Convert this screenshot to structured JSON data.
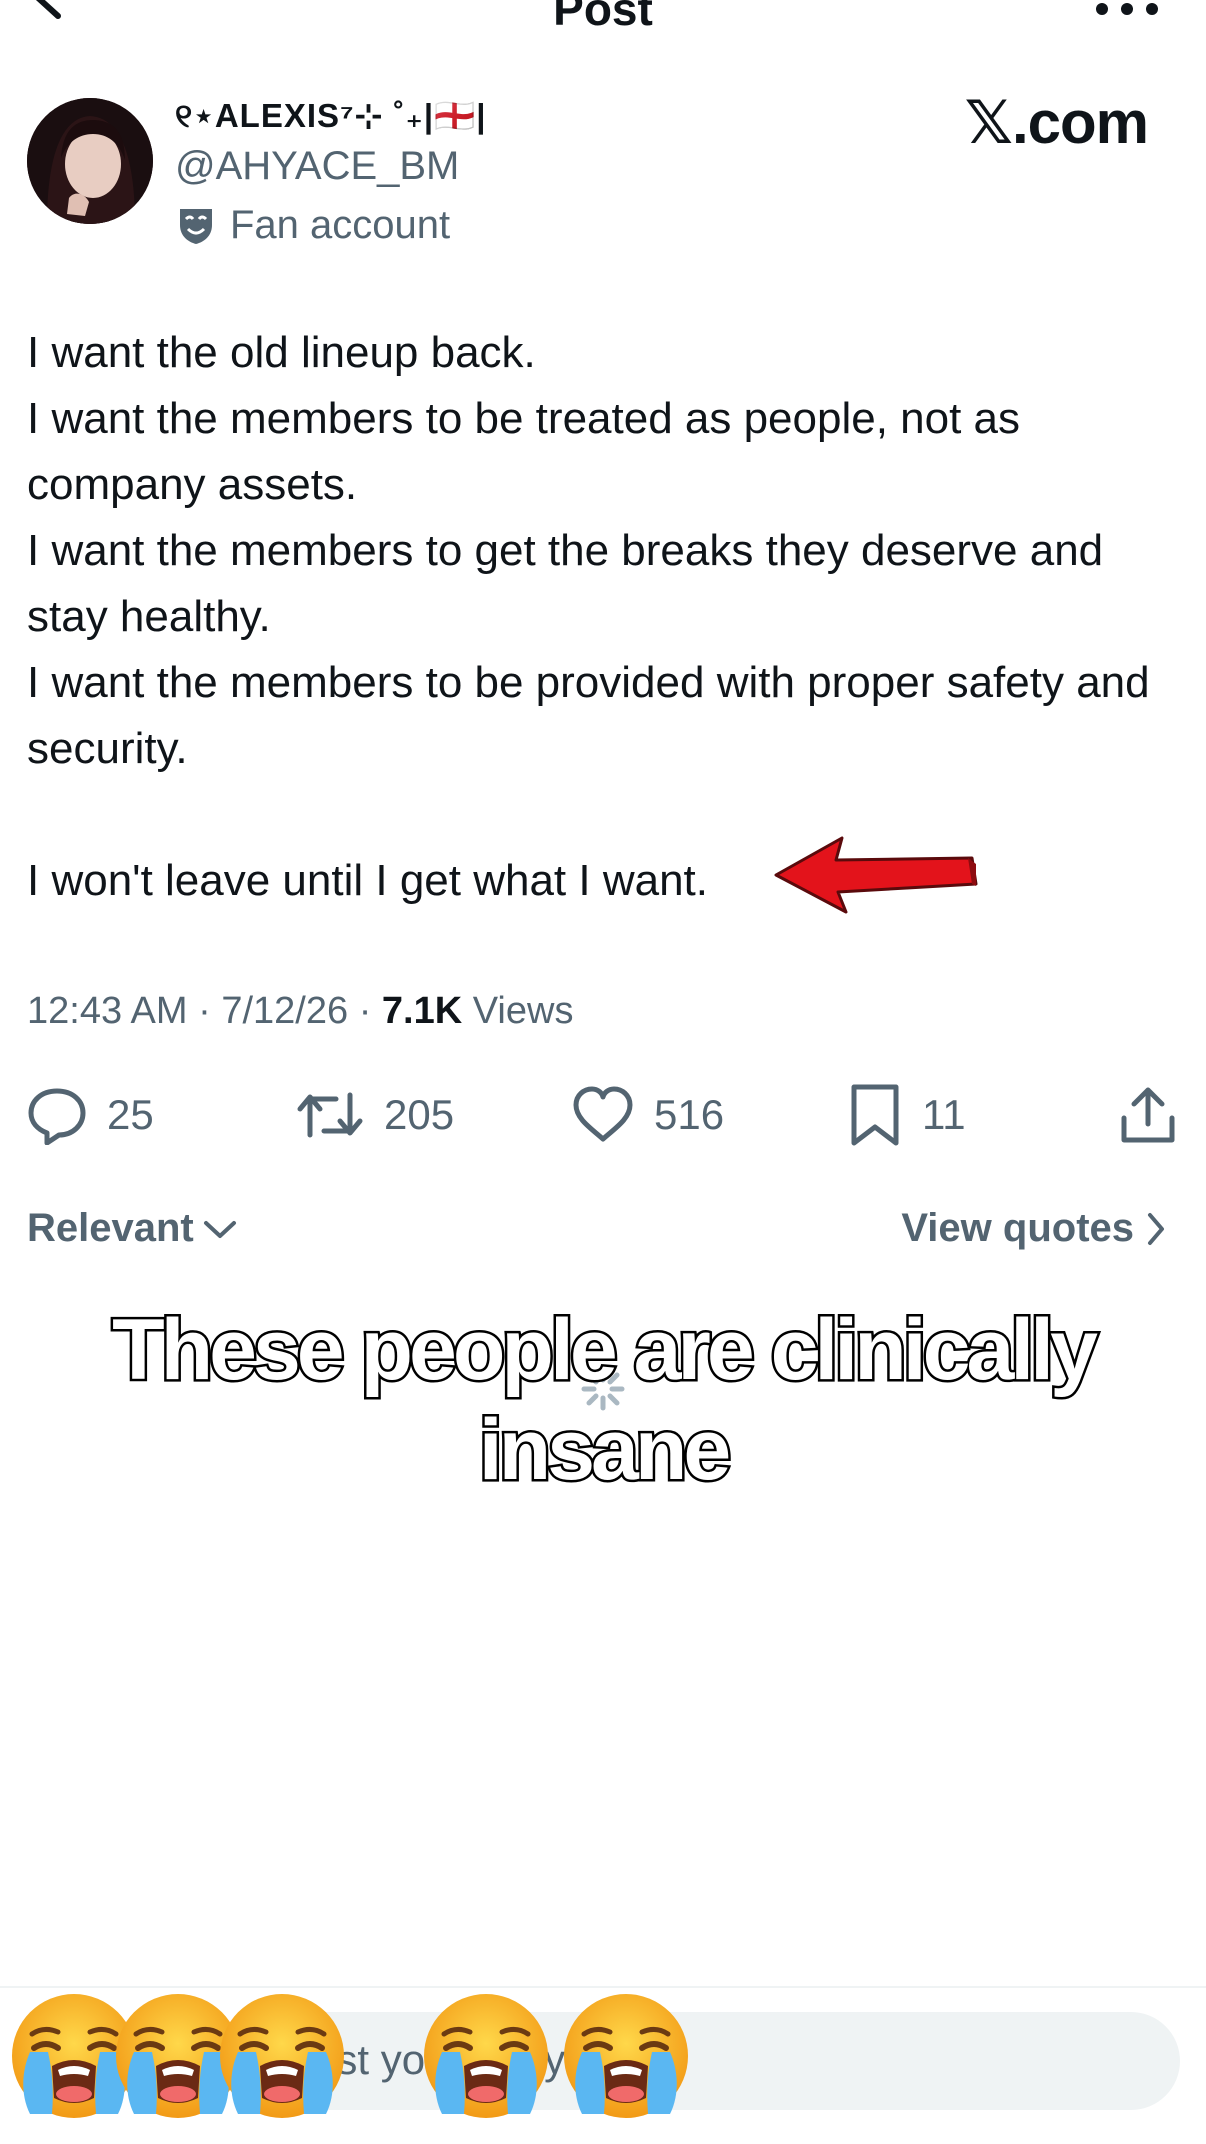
{
  "header": {
    "title": "Post"
  },
  "author": {
    "display_name": "୧⋆ALEXIS⁷⊹ ˚₊|🏴󠁧󠁢󠁥󠁮󠁧󠁿|",
    "handle": "@AHYACE_BM",
    "badge_label": "Fan account"
  },
  "brand": "𝕏.com",
  "post": {
    "text": "I want the old lineup back.\nI want the members to be treated as people, not as company assets.\nI want the members to get the breaks they deserve and stay healthy.\nI want the members to be provided with proper safety and security.\n\nI won't leave until I get what I want.",
    "time": "12:43 AM",
    "date": "7/12/26",
    "views_count": "7.1K",
    "views_label": "Views"
  },
  "actions": {
    "replies": "25",
    "reposts": "205",
    "likes": "516",
    "bookmarks": "11"
  },
  "sort": {
    "label": "Relevant",
    "quotes_label": "View quotes"
  },
  "overlay": {
    "caption": "These people are clinically insane"
  },
  "reply": {
    "placeholder": "Post your reply"
  },
  "colors": {
    "text": "#0f1419",
    "secondary": "#536471",
    "arrow": "#e3131b",
    "divider": "#eff3f4"
  },
  "icons": [
    "back-arrow-icon",
    "more-icon",
    "fan-account-icon",
    "reply-icon",
    "repost-icon",
    "like-icon",
    "bookmark-icon",
    "share-icon",
    "chevron-down-icon",
    "chevron-right-icon",
    "loading-spinner-icon",
    "crying-emoji-icon"
  ]
}
